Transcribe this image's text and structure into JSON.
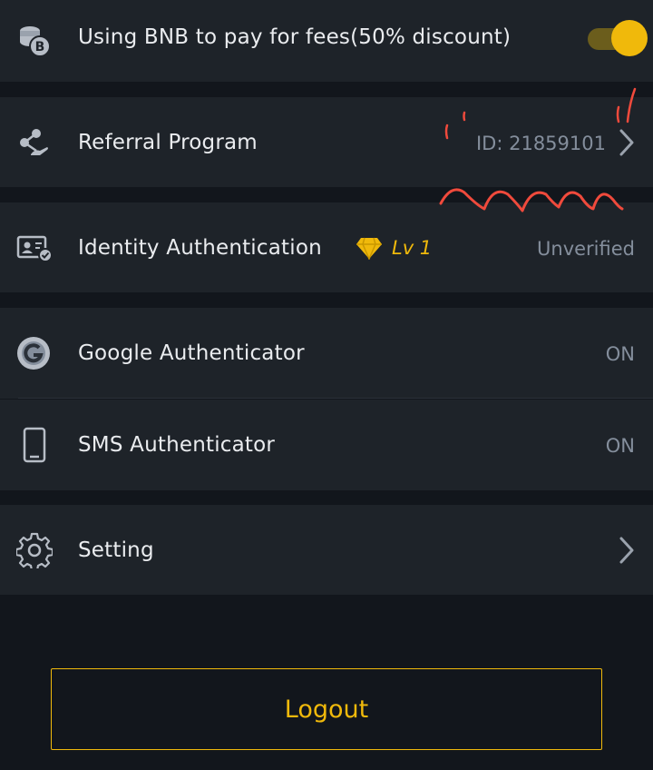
{
  "rows": {
    "bnb_fees": {
      "label": "Using BNB to pay for fees(50% discount)",
      "icon": "bnb-coin-icon",
      "toggle": "on"
    },
    "referral": {
      "label": "Referral Program",
      "icon": "share-hand-icon",
      "value": "ID: 21859101"
    },
    "identity": {
      "label": "Identity Authentication",
      "icon": "id-card-check-icon",
      "level": "Lv 1",
      "level_icon": "diamond-icon",
      "value": "Unverified"
    },
    "google_auth": {
      "label": "Google Authenticator",
      "icon": "google-authenticator-icon",
      "value": "ON"
    },
    "sms_auth": {
      "label": "SMS Authenticator",
      "icon": "phone-icon",
      "value": "ON"
    },
    "setting": {
      "label": "Setting",
      "icon": "gear-icon"
    }
  },
  "logout_label": "Logout",
  "colors": {
    "background": "#12161c",
    "row": "#1e2329",
    "accent": "#f0b90b",
    "text": "#eaecef",
    "muted": "#848e9c",
    "annotation": "#f04a3c"
  }
}
